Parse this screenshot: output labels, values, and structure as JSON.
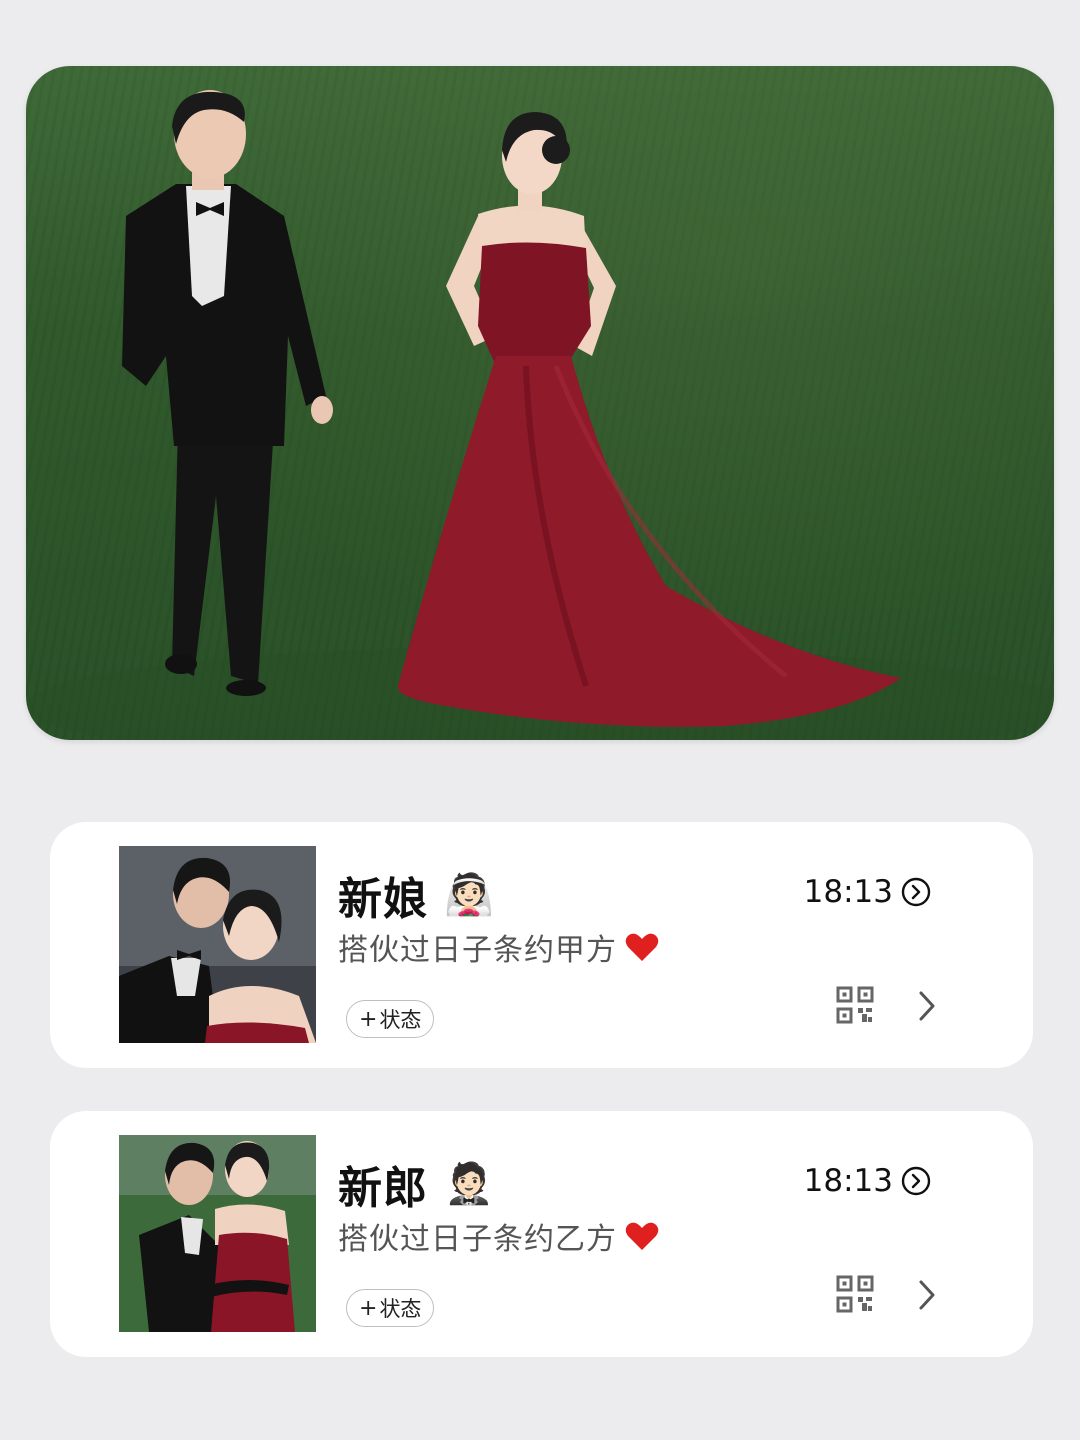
{
  "hero": {
    "image": "couple-on-grass-photo"
  },
  "contacts": [
    {
      "name": "新娘",
      "emoji": "👰🏻",
      "signature": "搭伙过日子条约甲方",
      "time": "18:13",
      "status_label": "状态",
      "status_plus": "+",
      "icons": [
        "play-circle-icon",
        "heart-icon",
        "qr-code-icon",
        "chevron-right-icon"
      ]
    },
    {
      "name": "新郎",
      "emoji": "🤵🏻",
      "signature": "搭伙过日子条约乙方",
      "time": "18:13",
      "status_label": "状态",
      "status_plus": "+",
      "icons": [
        "play-circle-icon",
        "heart-icon",
        "qr-code-icon",
        "chevron-right-icon"
      ]
    }
  ],
  "colors": {
    "background": "#ececee",
    "card": "#ffffff",
    "heart": "#e0201f",
    "grass": "#33602f",
    "dress": "#8e1a2a"
  }
}
